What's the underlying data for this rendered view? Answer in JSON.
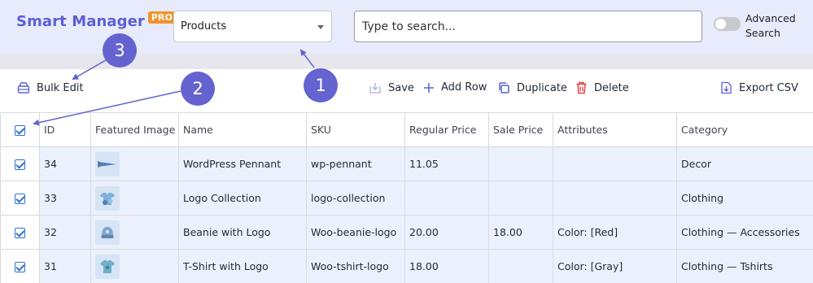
{
  "brand": {
    "name": "Smart Manager",
    "badge": "PRO"
  },
  "header": {
    "dashboard_select": "Products",
    "search_placeholder": "Type to search...",
    "advanced_search_label_line1": "Advanced",
    "advanced_search_label_line2": "Search"
  },
  "toolbar": {
    "bulk_edit": "Bulk Edit",
    "save": "Save",
    "add_row": "Add Row",
    "duplicate": "Duplicate",
    "delete": "Delete",
    "export_csv": "Export CSV"
  },
  "table": {
    "columns": [
      "ID",
      "Featured Image",
      "Name",
      "SKU",
      "Regular Price",
      "Sale Price",
      "Attributes",
      "Category"
    ],
    "rows": [
      {
        "id": "34",
        "name": "WordPress Pennant",
        "sku": "wp-pennant",
        "regular_price": "11.05",
        "sale_price": "",
        "attributes": "",
        "category": "Decor",
        "image_icon": "pennant-icon"
      },
      {
        "id": "33",
        "name": "Logo Collection",
        "sku": "logo-collection",
        "regular_price": "",
        "sale_price": "",
        "attributes": "",
        "category": "Clothing",
        "image_icon": "logo-collection-icon"
      },
      {
        "id": "32",
        "name": "Beanie with Logo",
        "sku": "Woo-beanie-logo",
        "regular_price": "20.00",
        "sale_price": "18.00",
        "attributes": "Color: [Red]",
        "category": "Clothing — Accessories",
        "image_icon": "beanie-icon"
      },
      {
        "id": "31",
        "name": "T-Shirt with Logo",
        "sku": "Woo-tshirt-logo",
        "regular_price": "18.00",
        "sale_price": "",
        "attributes": "Color: [Gray]",
        "category": "Clothing — Tshirts",
        "image_icon": "tshirt-icon"
      }
    ]
  },
  "annotations": {
    "one": "1",
    "two": "2",
    "three": "3"
  },
  "colors": {
    "accent": "#5b5fd4",
    "badge": "#f0932b",
    "header_bg": "#e8ebfc",
    "row_bg": "#eaf1fc",
    "annotation": "#6463cf",
    "delete_red": "#e03c3c",
    "checkbox": "#2f6fd1"
  }
}
